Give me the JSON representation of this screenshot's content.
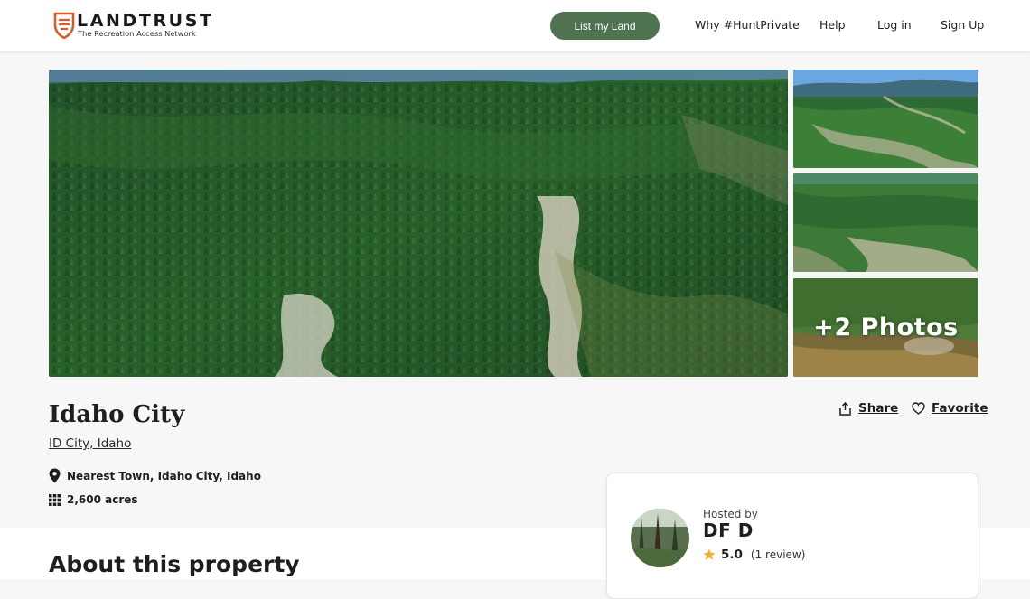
{
  "nav": {
    "brand": "LANDTRUST",
    "tagline": "The Recreation Access Network",
    "cta": "List my Land",
    "links": [
      "Why #HuntPrivate",
      "Help",
      "Log in",
      "Sign Up"
    ]
  },
  "gallery": {
    "more_photos": "+2 Photos"
  },
  "listing": {
    "title": "Idaho City",
    "location": "ID City, Idaho",
    "share": "Share",
    "favorite": "Favorite",
    "nearest_town": "Nearest Town, Idaho City, Idaho",
    "acreage": "2,600 acres"
  },
  "host": {
    "hosted_by": "Hosted by",
    "name": "DF D",
    "rating": "5.0",
    "reviews": "(1 review)"
  },
  "sections": {
    "about_title": "About this property"
  },
  "colors": {
    "brand_green": "#4f7350",
    "brand_orange": "#d95b2b",
    "star": "#f2b134"
  },
  "icons": {
    "share": "share-icon",
    "favorite": "heart-icon",
    "location": "map-pin-icon",
    "acreage": "grid-icon",
    "star": "star-icon"
  }
}
